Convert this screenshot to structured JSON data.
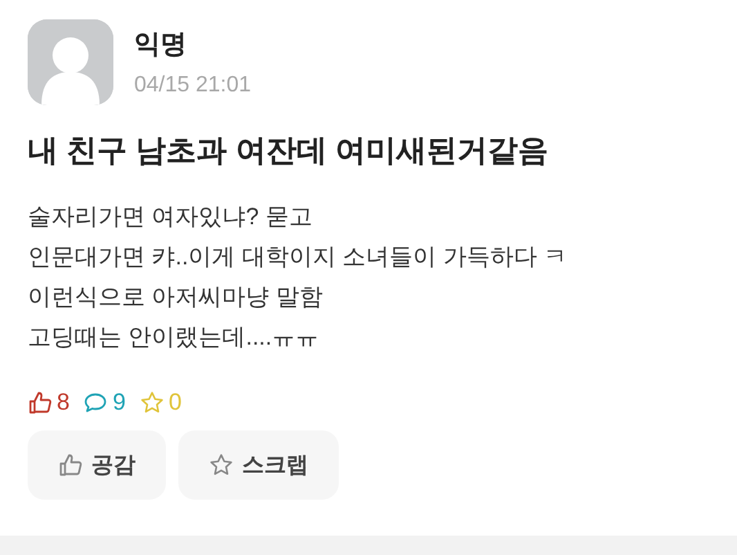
{
  "post": {
    "author": "익명",
    "time": "04/15 21:01",
    "title": "내 친구 남초과 여잔데 여미새된거같음",
    "body": [
      "술자리가면 여자있냐? 묻고",
      "인문대가면 캬..이게 대학이지 소녀들이 가득하다 ㅋ",
      "이런식으로 아저씨마냥 말함",
      "고딩때는 안이랬는데....ㅠㅠ"
    ],
    "stats": [
      {
        "kind": "like",
        "count": "8",
        "color": "#c0392b"
      },
      {
        "kind": "comment",
        "count": "9",
        "color": "#1fa3b5"
      },
      {
        "kind": "scrap",
        "count": "0",
        "color": "#e0c43a"
      }
    ],
    "buttons": [
      {
        "kind": "like",
        "label": "공감"
      },
      {
        "kind": "scrap",
        "label": "스크랩"
      }
    ]
  }
}
